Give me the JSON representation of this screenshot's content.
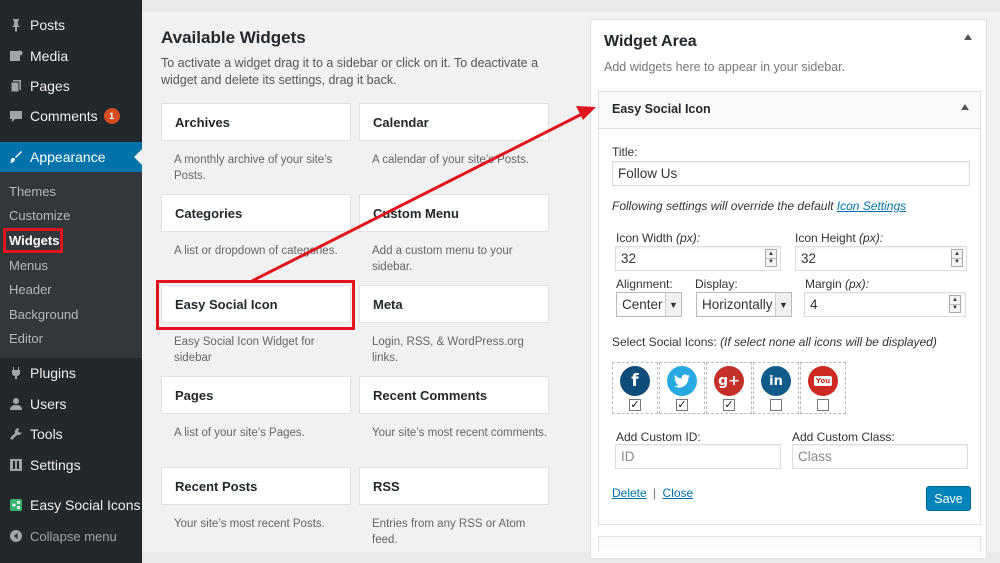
{
  "sidebar": {
    "items": [
      {
        "label": "Posts",
        "icon": "pushpin-icon"
      },
      {
        "label": "Media",
        "icon": "media-icon"
      },
      {
        "label": "Pages",
        "icon": "pages-icon"
      },
      {
        "label": "Comments",
        "icon": "comments-icon",
        "badge": "1"
      },
      {
        "label": "Appearance",
        "icon": "paintbrush-icon"
      },
      {
        "label": "Plugins",
        "icon": "plug-icon"
      },
      {
        "label": "Users",
        "icon": "users-icon"
      },
      {
        "label": "Tools",
        "icon": "wrench-icon"
      },
      {
        "label": "Settings",
        "icon": "settings-icon"
      },
      {
        "label": "Easy Social Icons",
        "icon": "share-icon"
      },
      {
        "label": "Collapse menu",
        "icon": "collapse-icon"
      }
    ],
    "appearance_submenu": [
      "Themes",
      "Customize",
      "Widgets",
      "Menus",
      "Header",
      "Background",
      "Editor"
    ],
    "current_submenu": "Widgets"
  },
  "available_widgets": {
    "title": "Available Widgets",
    "description": "To activate a widget drag it to a sidebar or click on it. To deactivate a widget and delete its settings, drag it back.",
    "widgets": [
      {
        "name": "Archives",
        "desc": "A monthly archive of your site’s Posts."
      },
      {
        "name": "Calendar",
        "desc": "A calendar of your site’s Posts."
      },
      {
        "name": "Categories",
        "desc": "A list or dropdown of categories."
      },
      {
        "name": "Custom Menu",
        "desc": "Add a custom menu to your sidebar."
      },
      {
        "name": "Easy Social Icon",
        "desc": "Easy Social Icon Widget for sidebar"
      },
      {
        "name": "Meta",
        "desc": "Login, RSS, & WordPress.org links."
      },
      {
        "name": "Pages",
        "desc": "A list of your site’s Pages."
      },
      {
        "name": "Recent Comments",
        "desc": "Your site’s most recent comments."
      },
      {
        "name": "Recent Posts",
        "desc": "Your site’s most recent Posts."
      },
      {
        "name": "RSS",
        "desc": "Entries from any RSS or Atom feed."
      }
    ]
  },
  "widget_area": {
    "title": "Widget Area",
    "description": "Add widgets here to appear in your sidebar.",
    "widget": {
      "header": "Easy Social Icon",
      "title_label": "Title:",
      "title_value": "Follow Us",
      "override_note": "Following settings will override the default ",
      "override_link": "Icon Settings",
      "icon_width_label": "Icon Width ",
      "icon_height_label": "Icon Height ",
      "px_unit": "(px):",
      "icon_width_value": "32",
      "icon_height_value": "32",
      "alignment_label": "Alignment:",
      "alignment_value": "Center",
      "display_label": "Display:",
      "display_value": "Horizontally",
      "margin_label": "Margin ",
      "margin_value": "4",
      "select_icons_label": "Select Social Icons: ",
      "select_icons_note": "(If select none all icons will be displayed)",
      "social_icons": [
        {
          "name": "facebook",
          "glyph": "f",
          "color": "#0e4c7a",
          "checked": true
        },
        {
          "name": "twitter",
          "glyph": "t",
          "color": "#29a9e1",
          "checked": true
        },
        {
          "name": "google-plus",
          "glyph": "g+",
          "color": "#c6302a",
          "checked": true
        },
        {
          "name": "linkedin",
          "glyph": "in",
          "color": "#0f5c8a",
          "checked": false
        },
        {
          "name": "youtube",
          "glyph": "You",
          "color": "#cc2a22",
          "checked": false
        }
      ],
      "custom_id_label": "Add Custom ID:",
      "custom_id_placeholder": "ID",
      "custom_class_label": "Add Custom Class:",
      "custom_class_placeholder": "Class",
      "delete_label": "Delete",
      "separator": "|",
      "close_label": "Close",
      "save_label": "Save"
    }
  },
  "colors": {
    "admin_bar": "#23282d",
    "accent": "#0073aa",
    "highlight": "#e0141e",
    "save_button": "#0085ba"
  }
}
